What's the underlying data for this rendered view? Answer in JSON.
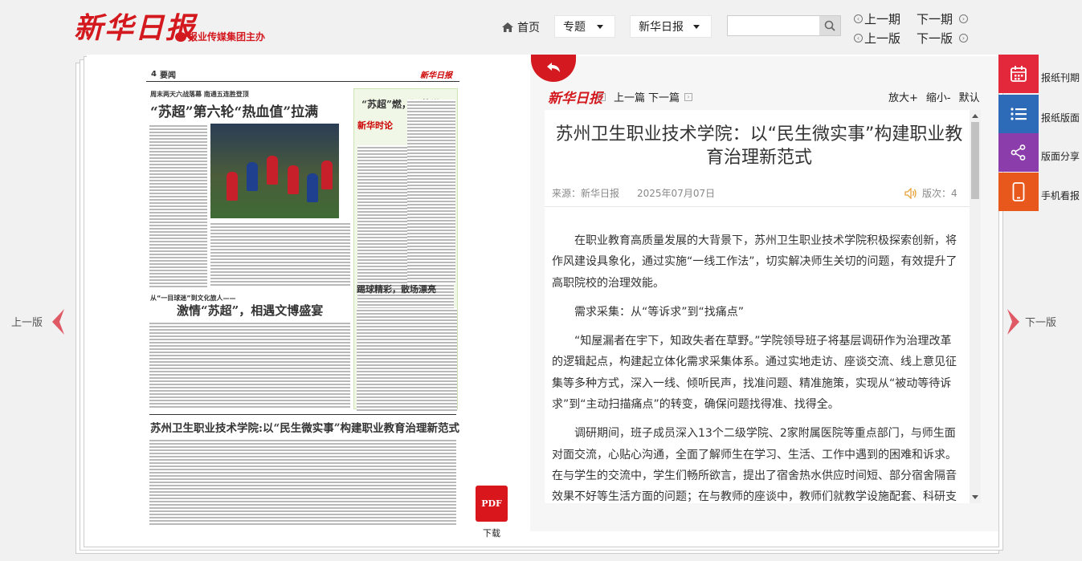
{
  "header": {
    "logo": "新华日报",
    "logo_sub": "报业传媒集团主办",
    "home": "首页",
    "topic": "专题",
    "paper": "新华日报",
    "search_placeholder": "",
    "prev_issue": "上一期",
    "next_issue": "下一期",
    "prev_page": "上一版",
    "next_page": "下一版"
  },
  "newspaper": {
    "page_no": "4",
    "section": "要闻",
    "masthead": "新华日报",
    "kicker1": "周末两天六战落幕 南通五连胜登顶",
    "headline1": "“苏超”第六轮“热血值”拉满",
    "green_title": "“苏超”燃，江苏燃！",
    "green_badge": "新华时论",
    "kicker2": "从“一目球迷”到文化旅人——",
    "headline2": "激情“苏超”，相遇文博盛宴",
    "headline3": "踢球精彩，散场漂亮",
    "headline4": "苏州卫生职业技术学院:以“民生微实事”构建职业教育治理新范式",
    "download": "下载",
    "pdf": "PDF"
  },
  "article": {
    "mini_logo": "新华日报",
    "prev": "上一篇",
    "next": "下一篇",
    "zoom_in": "放大+",
    "zoom_out": "缩小-",
    "zoom_default": "默认",
    "title": "苏州卫生职业技术学院：以“民生微实事”构建职业教育治理新范式",
    "source": "来源：新华日报",
    "date": "2025年07月07日",
    "banci": "版次：4",
    "paragraphs": [
      "在职业教育高质量发展的大背景下，苏州卫生职业技术学院积极探索创新，将作风建设具象化，通过实施“一线工作法”，切实解决师生关切的问题，有效提升了高职院校的治理效能。",
      "需求采集：从“等诉求”到“找痛点”",
      "“知屋漏者在宇下，知政失者在草野。”学院领导班子将基层调研作为治理改革的逻辑起点，构建起立体化需求采集体系。通过实地走访、座谈交流、线上意见征集等多种方式，深入一线、倾听民声，找准问题、精准施策，实现从“被动等待诉求”到“主动扫描痛点”的转变，确保问题找得准、找得全。",
      "调研期间，班子成员深入13个二级学院、2家附属医院等重点部门，与师生面对面交流，心贴心沟通，全面了解师生在学习、生活、工作中遇到的困难和诉求。在与学生的交流中，学生们畅所欲言，提出了宿舍热水供应时间短、部分宿舍隔音效果不好等生活方面的问题；在与教师的座谈中，教师们就教学设施配套、科研支"
    ]
  },
  "side": {
    "prev_page": "上一版",
    "next_page": "下一版"
  },
  "tools": [
    {
      "label": "报纸刊期",
      "color": "#e3283b"
    },
    {
      "label": "报纸版面",
      "color": "#2d6ab8"
    },
    {
      "label": "版面分享",
      "color": "#8c3dac"
    },
    {
      "label": "手机看报",
      "color": "#e8571b"
    }
  ]
}
